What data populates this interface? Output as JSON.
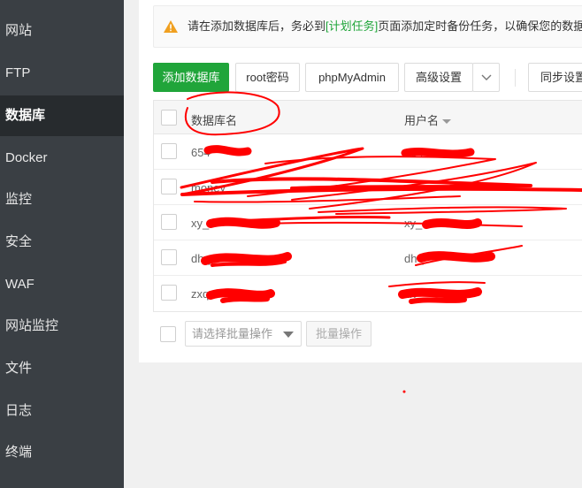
{
  "sidebar": {
    "items": [
      {
        "label": "网站"
      },
      {
        "label": "FTP"
      },
      {
        "label": "数据库"
      },
      {
        "label": "Docker"
      },
      {
        "label": "监控"
      },
      {
        "label": "安全"
      },
      {
        "label": "WAF"
      },
      {
        "label": "网站监控"
      },
      {
        "label": "文件"
      },
      {
        "label": "日志"
      },
      {
        "label": "终端"
      }
    ],
    "active_label": "数据库"
  },
  "notice": {
    "before": "请在添加数据库后，务必到",
    "link": "[计划任务]",
    "after": "页面添加定时备份任务，以确保您的数据"
  },
  "toolbar": {
    "add_db": "添加数据库",
    "root_pw": "root密码",
    "phpmyadmin": "phpMyAdmin",
    "advanced": "高级设置",
    "sync": "同步设置"
  },
  "table": {
    "col_dbname": "数据库名",
    "col_username": "用户名",
    "rows": [
      {
        "dbname": "654",
        "username": "654"
      },
      {
        "dbname": "money_",
        "username": ""
      },
      {
        "dbname": "xy_",
        "username": "xy_"
      },
      {
        "dbname": "dh_",
        "username": "dh_"
      },
      {
        "dbname": "zxq",
        "username": "zx"
      }
    ]
  },
  "batch": {
    "select_placeholder": "请选择批量操作",
    "button": "批量操作"
  },
  "colors": {
    "sidebar_bg": "#3a3f44",
    "sidebar_active_bg": "#272b2e",
    "accent_green": "#20a53a",
    "warning_orange": "#f0a020",
    "scribble_red": "#ff0000"
  }
}
